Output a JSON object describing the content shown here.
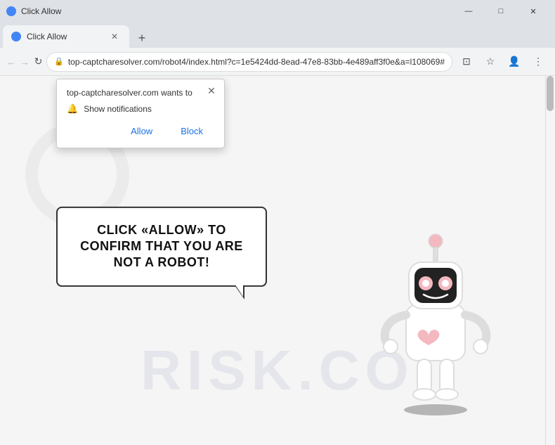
{
  "window": {
    "title": "Click Allow",
    "controls": {
      "minimize": "—",
      "maximize": "□",
      "close": "✕"
    }
  },
  "tab": {
    "favicon_color": "#4285f4",
    "title": "Click Allow",
    "close": "✕"
  },
  "nav": {
    "back": "←",
    "forward": "→",
    "refresh": "↻",
    "url": "top-captcharesolver.com/robot4/index.html?c=1e5424dd-8ead-47e8-83bb-4e489aff3f0e&a=l108069#",
    "new_tab": "+"
  },
  "popup": {
    "header": "top-captcharesolver.com wants to",
    "notification_text": "Show notifications",
    "allow_label": "Allow",
    "block_label": "Block",
    "close": "✕"
  },
  "page": {
    "bubble_text": "CLICK «ALLOW» TO CONFIRM THAT YOU ARE NOT A ROBOT!",
    "watermark": "risk.co"
  }
}
